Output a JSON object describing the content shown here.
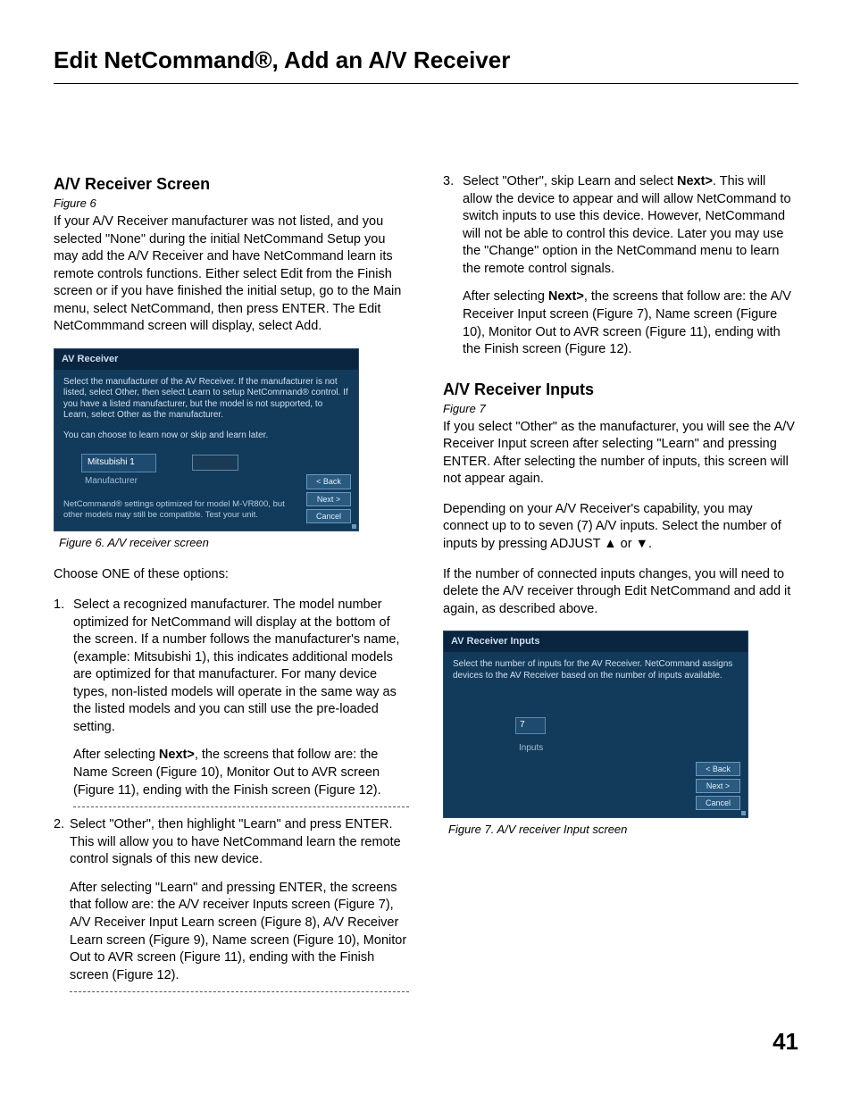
{
  "page_title": "Edit NetCommand®, Add an A/V Receiver",
  "left": {
    "h2": "A/V Receiver Screen",
    "fig_label": "Figure 6",
    "intro": "If your A/V Receiver manufacturer was not listed, and you selected \"None\" during the initial NetCommand Setup you may add the A/V Receiver and have NetCommand learn its remote controls functions.  Either select Edit from the Finish screen or if you have  finished the initial setup, go to the Main menu, select NetCommand, then press ENTER.  The Edit NetCommmand screen will display, select Add.",
    "scr1": {
      "title": "AV Receiver",
      "text1": "Select the manufacturer of the AV Receiver.  If the manufacturer is not listed, select Other, then select Learn to setup NetCommand® control.  If you have a listed manufacturer, but the model is not supported, to Learn, select Other as the manufacturer.",
      "text2": "You can choose to learn now or skip and learn later.",
      "field": "Mitsubishi 1",
      "sublabel": "Manufacturer",
      "note": "NetCommand® settings optimized for model M-VR800, but other models may still be compatible.  Test your unit.",
      "btn_back": "< Back",
      "btn_next": "Next >",
      "btn_cancel": "Cancel"
    },
    "caption1": "Figure 6.  A/V receiver screen",
    "choose": "Choose ONE of these options:",
    "li1a": "Select a recognized manufacturer.  The model number optimized for NetCommand will display at the bottom of the screen. If a number follows the manufacturer's name, (example: Mitsubishi 1), this indicates additional models are optimized for that manufacturer.  For many device types, non-listed models will operate in the same way as the listed models and you can still use the pre-loaded setting.",
    "li1b_pre": "After selecting ",
    "li1b_bold": "Next>",
    "li1b_post": ", the screens that follow are: the Name Screen (Figure 10), Monitor Out to AVR screen (Figure 11), ending with the Finish screen (Figure 12).",
    "li2a": "Select \"Other\", then highlight \"Learn\" and press ENTER.  This will allow you to have NetCommand learn the remote control signals of this new device.",
    "li2b": "After selecting \"Learn\" and pressing ENTER, the screens that follow are: the A/V receiver Inputs screen (Figure 7), A/V Receiver Input Learn screen (Figure 8), A/V Receiver Learn screen (Figure 9), Name screen (Figure 10), Monitor Out to AVR screen (Figure 11), ending with the Finish screen (Figure 12)."
  },
  "right": {
    "li3a_pre": "Select \"Other\", skip Learn and select ",
    "li3a_bold": "Next>",
    "li3a_post": ".  This will allow the device to appear and will allow NetCommand to switch inputs to use this device.  However, NetCommand will not be able to control this device.  Later you may use the \"Change\" option in the NetCommand menu to learn the remote control signals.",
    "li3b_pre": "After selecting ",
    "li3b_bold": "Next>",
    "li3b_post": ", the screens that follow are: the A/V Receiver Input screen (Figure 7), Name screen (Figure 10), Monitor Out to AVR screen (Figure 11), ending with the Finish screen (Figure 12).",
    "h2": "A/V Receiver Inputs",
    "fig_label": "Figure 7",
    "p1": "If  you select \"Other\" as the manufacturer, you will see the A/V Receiver Input screen after selecting \"Learn\" and pressing ENTER.  After selecting the number of inputs, this screen will not appear again.",
    "p2_pre": "Depending on your A/V Receiver's capability, you may connect up to to seven (7) A/V inputs.  Select the number of inputs by pressing  ADJUST ",
    "p2_mid": " or  ",
    "p2_post": ".",
    "p3": "If the number of connected inputs changes, you will need to delete the A/V receiver through Edit NetCommand and add it again, as described above.",
    "scr2": {
      "title": "AV Receiver Inputs",
      "text1": "Select the number of inputs for the AV Receiver.  NetCommand assigns devices to the AV Receiver based on the number of inputs available.",
      "field": "7",
      "sublabel": "Inputs",
      "btn_back": "< Back",
      "btn_next": "Next >",
      "btn_cancel": "Cancel"
    },
    "caption2": "Figure 7.  A/V receiver  Input screen"
  },
  "page_number": "41"
}
